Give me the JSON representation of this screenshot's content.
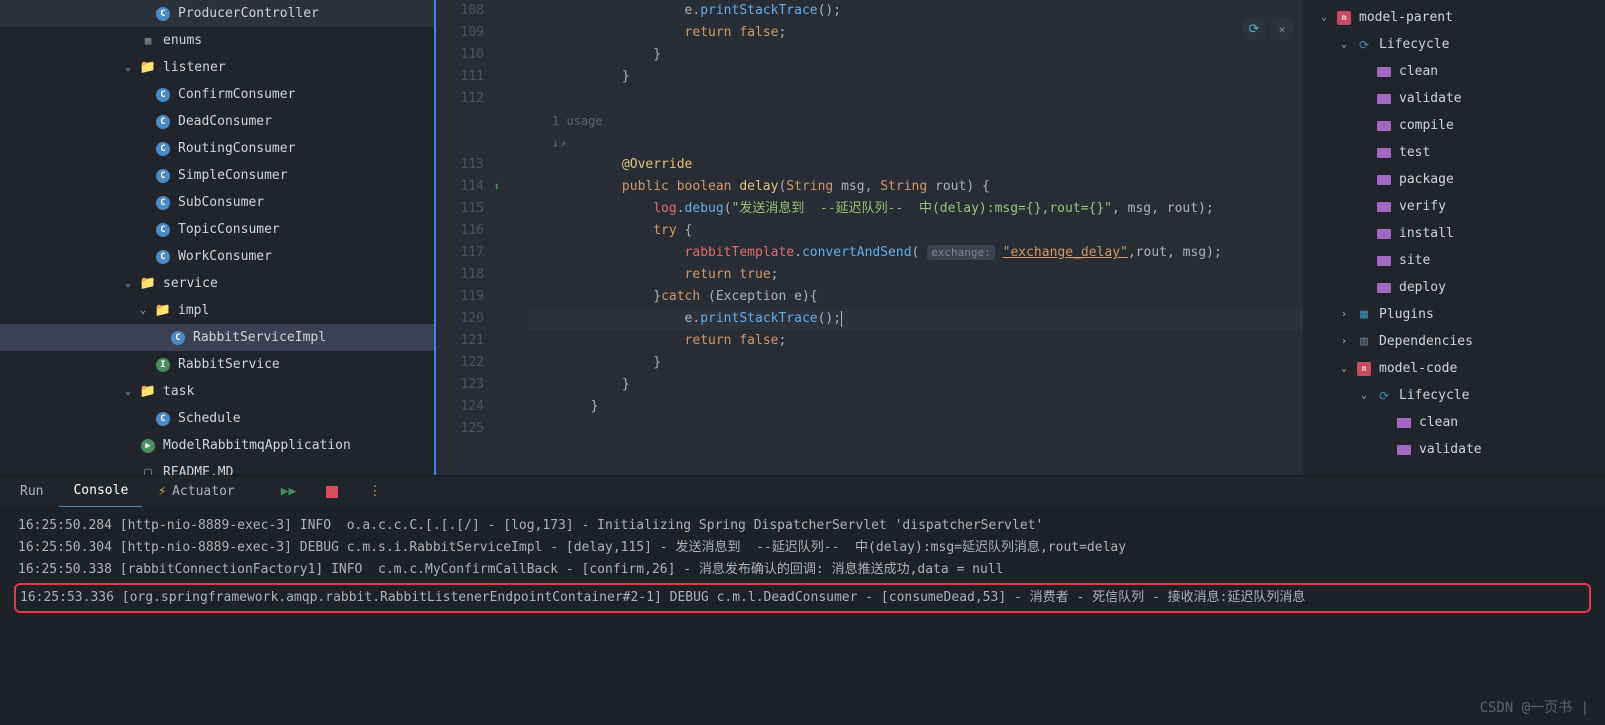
{
  "left_tree": [
    {
      "indent": 3,
      "icon": "class",
      "label": "ProducerController",
      "chevron": ""
    },
    {
      "indent": 2,
      "icon": "enum",
      "label": "enums",
      "chevron": ""
    },
    {
      "indent": 2,
      "icon": "folder",
      "label": "listener",
      "chevron": "v"
    },
    {
      "indent": 3,
      "icon": "class",
      "label": "ConfirmConsumer",
      "chevron": ""
    },
    {
      "indent": 3,
      "icon": "class",
      "label": "DeadConsumer",
      "chevron": ""
    },
    {
      "indent": 3,
      "icon": "class",
      "label": "RoutingConsumer",
      "chevron": ""
    },
    {
      "indent": 3,
      "icon": "class",
      "label": "SimpleConsumer",
      "chevron": ""
    },
    {
      "indent": 3,
      "icon": "class",
      "label": "SubConsumer",
      "chevron": ""
    },
    {
      "indent": 3,
      "icon": "class",
      "label": "TopicConsumer",
      "chevron": ""
    },
    {
      "indent": 3,
      "icon": "class",
      "label": "WorkConsumer",
      "chevron": ""
    },
    {
      "indent": 2,
      "icon": "folder-blue",
      "label": "service",
      "chevron": "v"
    },
    {
      "indent": 3,
      "icon": "folder",
      "label": "impl",
      "chevron": "v"
    },
    {
      "indent": 4,
      "icon": "class",
      "label": "RabbitServiceImpl",
      "chevron": "",
      "selected": true
    },
    {
      "indent": 3,
      "icon": "interface",
      "label": "RabbitService",
      "chevron": ""
    },
    {
      "indent": 2,
      "icon": "folder-purple",
      "label": "task",
      "chevron": "v"
    },
    {
      "indent": 3,
      "icon": "class",
      "label": "Schedule",
      "chevron": ""
    },
    {
      "indent": 2,
      "icon": "app",
      "label": "ModelRabbitmqApplication",
      "chevron": ""
    },
    {
      "indent": 2,
      "icon": "readme",
      "label": "README.MD",
      "chevron": ""
    }
  ],
  "gutter": [
    "108",
    "109",
    "110",
    "111",
    "112",
    "",
    "",
    "113",
    "114",
    "115",
    "116",
    "117",
    "118",
    "119",
    "120",
    "121",
    "122",
    "123",
    "124",
    "125"
  ],
  "gutter_markers": {
    "114": "↑"
  },
  "usage_hint": "1 usage",
  "author_hint": "↓↗",
  "code_lines": [
    {
      "n": 108,
      "tokens": [
        {
          "t": "                    e",
          "c": "white"
        },
        {
          "t": ".",
          "c": "white"
        },
        {
          "t": "printStackTrace",
          "c": "blue"
        },
        {
          "t": "();",
          "c": "white"
        }
      ]
    },
    {
      "n": 109,
      "tokens": [
        {
          "t": "                    ",
          "c": "white"
        },
        {
          "t": "return false",
          "c": "orange"
        },
        {
          "t": ";",
          "c": "white"
        }
      ]
    },
    {
      "n": 110,
      "tokens": [
        {
          "t": "                }",
          "c": "white"
        }
      ]
    },
    {
      "n": 111,
      "tokens": [
        {
          "t": "            }",
          "c": "white"
        }
      ]
    },
    {
      "n": 112,
      "tokens": []
    },
    {
      "n": -1,
      "usage": true
    },
    {
      "n": -2,
      "author": true
    },
    {
      "n": 113,
      "tokens": [
        {
          "t": "            ",
          "c": "white"
        },
        {
          "t": "@Override",
          "c": "yellow"
        }
      ]
    },
    {
      "n": 114,
      "tokens": [
        {
          "t": "            ",
          "c": "white"
        },
        {
          "t": "public boolean ",
          "c": "orange"
        },
        {
          "t": "delay",
          "c": "yellow"
        },
        {
          "t": "(",
          "c": "white"
        },
        {
          "t": "String ",
          "c": "orange"
        },
        {
          "t": "msg",
          "c": "white"
        },
        {
          "t": ", ",
          "c": "white"
        },
        {
          "t": "String ",
          "c": "orange"
        },
        {
          "t": "rout",
          "c": "white"
        },
        {
          "t": ") {",
          "c": "white"
        }
      ]
    },
    {
      "n": 115,
      "tokens": [
        {
          "t": "                ",
          "c": "white"
        },
        {
          "t": "log",
          "c": "red"
        },
        {
          "t": ".",
          "c": "white"
        },
        {
          "t": "debug",
          "c": "blue"
        },
        {
          "t": "(",
          "c": "white"
        },
        {
          "t": "\"发送消息到  --延迟队列--  中(delay):msg={},rout={}\"",
          "c": "green"
        },
        {
          "t": ", msg, rout);",
          "c": "white"
        }
      ]
    },
    {
      "n": 116,
      "tokens": [
        {
          "t": "                ",
          "c": "white"
        },
        {
          "t": "try ",
          "c": "orange"
        },
        {
          "t": "{",
          "c": "white"
        }
      ]
    },
    {
      "n": 117,
      "tokens": [
        {
          "t": "                    ",
          "c": "white"
        },
        {
          "t": "rabbitTemplate",
          "c": "red"
        },
        {
          "t": ".",
          "c": "white"
        },
        {
          "t": "convertAndSend",
          "c": "blue"
        },
        {
          "t": "( ",
          "c": "white"
        },
        {
          "t": "exchange:",
          "c": "hint"
        },
        {
          "t": " ",
          "c": "white"
        },
        {
          "t": "\"exchange_delay\"",
          "c": "link"
        },
        {
          "t": ",rout, msg);",
          "c": "white"
        }
      ]
    },
    {
      "n": 118,
      "tokens": [
        {
          "t": "                    ",
          "c": "white"
        },
        {
          "t": "return true",
          "c": "orange"
        },
        {
          "t": ";",
          "c": "white"
        }
      ]
    },
    {
      "n": 119,
      "tokens": [
        {
          "t": "                }",
          "c": "white"
        },
        {
          "t": "catch ",
          "c": "orange"
        },
        {
          "t": "(Exception e){",
          "c": "white"
        }
      ]
    },
    {
      "n": 120,
      "highlight": true,
      "tokens": [
        {
          "t": "                    e",
          "c": "white"
        },
        {
          "t": ".",
          "c": "white"
        },
        {
          "t": "printStackTrace",
          "c": "blue"
        },
        {
          "t": "();",
          "c": "white"
        }
      ],
      "cursor": true
    },
    {
      "n": 121,
      "tokens": [
        {
          "t": "                    ",
          "c": "white"
        },
        {
          "t": "return false",
          "c": "orange"
        },
        {
          "t": ";",
          "c": "white"
        }
      ]
    },
    {
      "n": 122,
      "tokens": [
        {
          "t": "                }",
          "c": "white"
        }
      ]
    },
    {
      "n": 123,
      "tokens": [
        {
          "t": "            }",
          "c": "white"
        }
      ]
    },
    {
      "n": 124,
      "tokens": [
        {
          "t": "        }",
          "c": "white"
        }
      ]
    },
    {
      "n": 125,
      "tokens": []
    }
  ],
  "right_tree": [
    {
      "indent": 1,
      "icon": "maven",
      "label": "model-parent",
      "chevron": "v"
    },
    {
      "indent": 2,
      "icon": "lifecycle",
      "label": "Lifecycle",
      "chevron": "v"
    },
    {
      "indent": 3,
      "icon": "goal",
      "label": "clean"
    },
    {
      "indent": 3,
      "icon": "goal",
      "label": "validate"
    },
    {
      "indent": 3,
      "icon": "goal",
      "label": "compile"
    },
    {
      "indent": 3,
      "icon": "goal",
      "label": "test"
    },
    {
      "indent": 3,
      "icon": "goal",
      "label": "package"
    },
    {
      "indent": 3,
      "icon": "goal",
      "label": "verify"
    },
    {
      "indent": 3,
      "icon": "goal",
      "label": "install"
    },
    {
      "indent": 3,
      "icon": "goal",
      "label": "site"
    },
    {
      "indent": 3,
      "icon": "goal",
      "label": "deploy"
    },
    {
      "indent": 2,
      "icon": "plugins",
      "label": "Plugins",
      "chevron": ">"
    },
    {
      "indent": 2,
      "icon": "deps",
      "label": "Dependencies",
      "chevron": ">"
    },
    {
      "indent": 2,
      "icon": "maven",
      "label": "model-code",
      "chevron": "v"
    },
    {
      "indent": 3,
      "icon": "lifecycle",
      "label": "Lifecycle",
      "chevron": "v"
    },
    {
      "indent": 4,
      "icon": "goal",
      "label": "clean"
    },
    {
      "indent": 4,
      "icon": "goal",
      "label": "validate"
    }
  ],
  "tabs": {
    "run": "Run",
    "console": "Console",
    "actuator": "Actuator"
  },
  "console": [
    "16:25:50.284 [http-nio-8889-exec-3] INFO  o.a.c.c.C.[.[.[/] - [log,173] - Initializing Spring DispatcherServlet 'dispatcherServlet'",
    "16:25:50.304 [http-nio-8889-exec-3] DEBUG c.m.s.i.RabbitServiceImpl - [delay,115] - 发送消息到  --延迟队列--  中(delay):msg=延迟队列消息,rout=delay",
    "16:25:50.338 [rabbitConnectionFactory1] INFO  c.m.c.MyConfirmCallBack - [confirm,26] - 消息发布确认的回调: 消息推送成功,data = null",
    "16:25:53.336 [org.springframework.amqp.rabbit.RabbitListenerEndpointContainer#2-1] DEBUG c.m.l.DeadConsumer - [consumeDead,53] - 消费者 - 死信队列 - 接收消息:延迟队列消息"
  ],
  "watermark": "CSDN @一页书 |"
}
